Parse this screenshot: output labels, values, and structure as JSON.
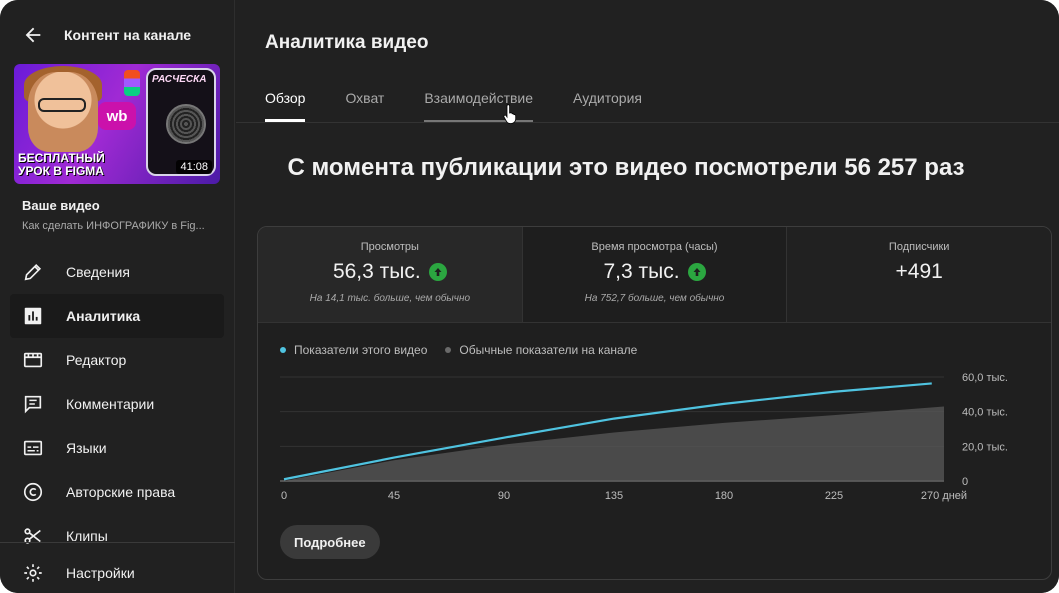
{
  "sidebar": {
    "back_title": "Контент на канале",
    "thumbnail": {
      "caption_line1": "БЕСПЛАТНЫЙ",
      "caption_line2": "УРОК В FIGMA",
      "badge_wb": "wb",
      "phone_label": "РАСЧЕСКА",
      "duration": "41:08"
    },
    "your_video_label": "Ваше видео",
    "video_title": "Как сделать ИНФОГРАФИКУ в Fig...",
    "items": [
      {
        "label": "Сведения",
        "icon": "pencil-icon"
      },
      {
        "label": "Аналитика",
        "icon": "analytics-icon",
        "active": true
      },
      {
        "label": "Редактор",
        "icon": "editor-icon"
      },
      {
        "label": "Комментарии",
        "icon": "comments-icon"
      },
      {
        "label": "Языки",
        "icon": "subtitles-icon"
      },
      {
        "label": "Авторские права",
        "icon": "copyright-icon"
      },
      {
        "label": "Клипы",
        "icon": "scissors-icon"
      }
    ],
    "bottom_item": {
      "label": "Настройки",
      "icon": "gear-icon"
    }
  },
  "main": {
    "title": "Аналитика видео",
    "tabs": [
      {
        "label": "Обзор",
        "active": true
      },
      {
        "label": "Охват"
      },
      {
        "label": "Взаимодействие",
        "hover": true
      },
      {
        "label": "Аудитория"
      }
    ],
    "headline": "С момента публикации это видео посмотрели 56 257 раз",
    "stats": [
      {
        "label": "Просмотры",
        "value": "56,3 тыс.",
        "trend": "up",
        "note": "На 14,1 тыс. больше, чем обычно"
      },
      {
        "label": "Время просмотра (часы)",
        "value": "7,3 тыс.",
        "trend": "up",
        "note": "На 752,7 больше, чем обычно"
      },
      {
        "label": "Подписчики",
        "value": "+491"
      }
    ],
    "more_button": "Подробнее"
  },
  "colors": {
    "background": "#212121",
    "series_video": "#4fc3e0",
    "series_typical": "#5a5a5a",
    "trend_up": "#2ba640"
  },
  "chart_data": {
    "type": "area",
    "x": [
      0,
      45,
      90,
      135,
      180,
      225,
      270
    ],
    "x_tick_labels": [
      "0",
      "45",
      "90",
      "135",
      "180",
      "225",
      "270 дней"
    ],
    "y_tick_labels": [
      "0",
      "20,0 тыс.",
      "40,0 тыс.",
      "60,0 тыс."
    ],
    "ylim": [
      0,
      60000
    ],
    "legend_placement": "top-left",
    "series": [
      {
        "name": "Показатели этого видео",
        "type": "line",
        "color": "#4fc3e0",
        "x": [
          0,
          45,
          90,
          135,
          180,
          225,
          265
        ],
        "values": [
          1000,
          13500,
          25000,
          36000,
          44500,
          51500,
          56300
        ]
      },
      {
        "name": "Обычные показатели на канале",
        "type": "area",
        "color": "#5a5a5a",
        "x": [
          0,
          45,
          90,
          135,
          180,
          225,
          270
        ],
        "values": [
          0,
          12000,
          21000,
          28000,
          33500,
          38000,
          43000
        ]
      }
    ]
  }
}
